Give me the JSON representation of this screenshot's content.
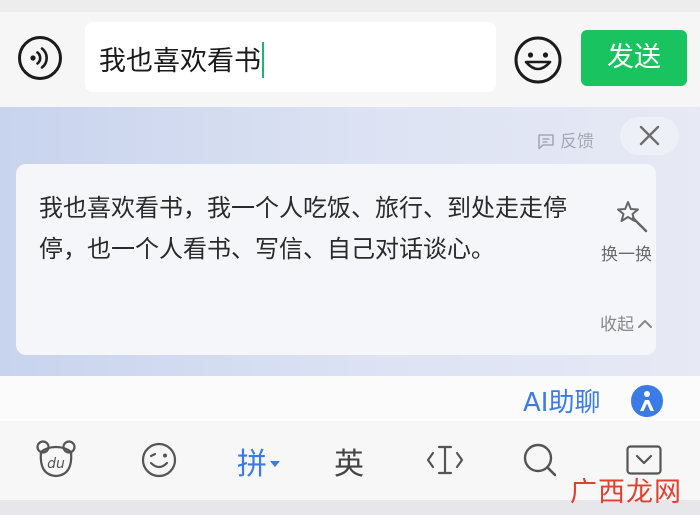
{
  "chat_input": {
    "text": "我也喜欢看书",
    "send_label": "发送"
  },
  "ai_suggestion": {
    "feedback_label": "反馈",
    "text": "我也喜欢看书，我一个人吃饭、旅行、到处走走停停，也一个人看书、写信、自己对话谈心。",
    "swap_label": "换一换",
    "collapse_label": "收起"
  },
  "ai_chat": {
    "label": "AI助聊"
  },
  "keyboard_toolbar": {
    "pinyin_label": "拼",
    "english_label": "英"
  },
  "watermark": {
    "text": "广西龙网"
  },
  "colors": {
    "send_green": "#19c35f",
    "accent_blue": "#3a7be6",
    "caret_green": "#1fb66b"
  },
  "icons": [
    "voice-icon",
    "emoji-icon",
    "feedback-icon",
    "close-icon",
    "magic-wand-icon",
    "ai-assistant-icon",
    "du-bear-icon",
    "emoji-face-icon",
    "text-cursor-icon",
    "search-icon",
    "keyboard-collapse-icon"
  ]
}
